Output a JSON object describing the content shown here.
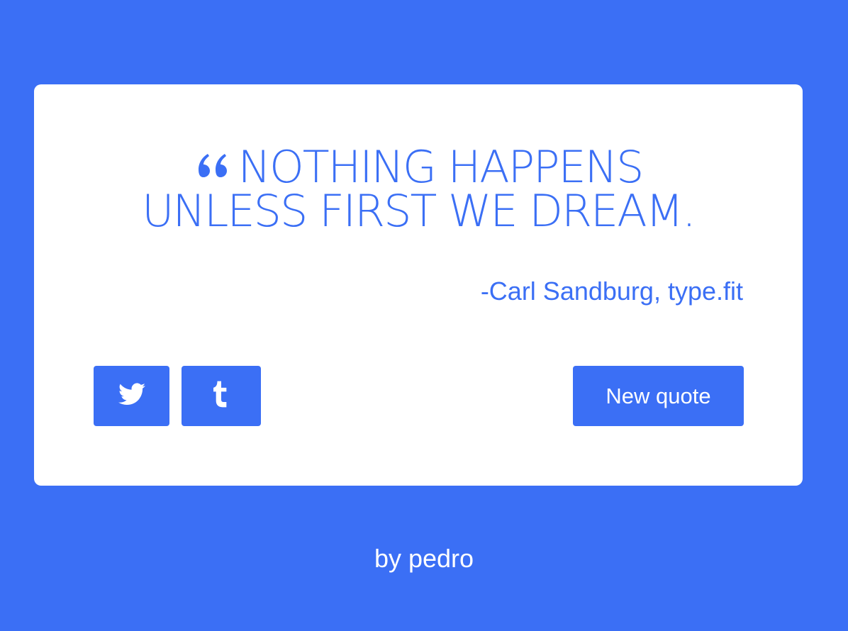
{
  "quote": {
    "text": "Nothing happens unless first we dream.",
    "author": "-Carl Sandburg, type.fit"
  },
  "buttons": {
    "twitter_icon": "twitter-icon",
    "tumblr_icon": "tumblr-icon",
    "new_quote_label": "New quote"
  },
  "footer": {
    "text": "by pedro"
  },
  "colors": {
    "accent": "#3b6ff5",
    "card": "#ffffff"
  }
}
